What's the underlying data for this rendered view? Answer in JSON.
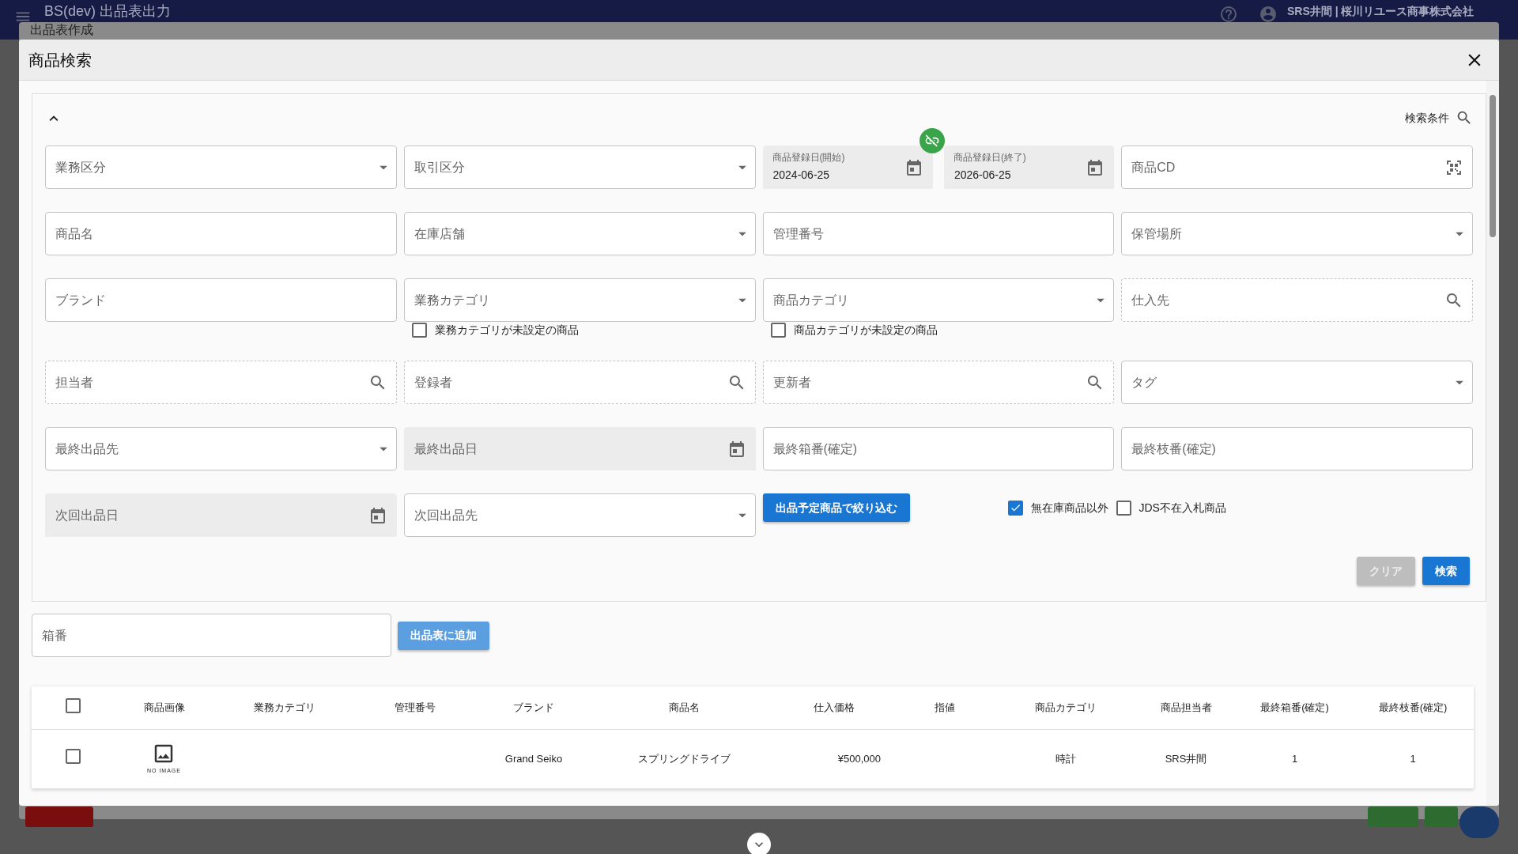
{
  "app_bar": {
    "title": "BS(dev) 出品表出力",
    "user": "SRS井間 | 桜川リユース商事株式会社"
  },
  "back_dialog": {
    "title": "出品表作成"
  },
  "dialog": {
    "title": "商品検索"
  },
  "search_panel": {
    "expanded": true,
    "title": "検索条件",
    "rows": [
      [
        {
          "kind": "select",
          "placeholder": "業務区分"
        },
        {
          "kind": "select",
          "placeholder": "取引区分"
        },
        {
          "kind": "date_range",
          "linked": false,
          "start": {
            "label": "商品登録日(開始)",
            "value": "2024-06-25"
          },
          "end": {
            "label": "商品登録日(終了)",
            "value": "2026-06-25"
          }
        },
        {
          "kind": "scan",
          "placeholder": "商品CD"
        }
      ],
      [
        {
          "kind": "text",
          "placeholder": "商品名"
        },
        {
          "kind": "select",
          "placeholder": "在庫店舗"
        },
        {
          "kind": "text",
          "placeholder": "管理番号"
        },
        {
          "kind": "select",
          "placeholder": "保管場所"
        }
      ],
      [
        {
          "kind": "text",
          "placeholder": "ブランド"
        },
        {
          "kind": "select",
          "placeholder": "業務カテゴリ",
          "checkbox": {
            "label": "業務カテゴリが未設定の商品",
            "checked": false
          }
        },
        {
          "kind": "select",
          "placeholder": "商品カテゴリ",
          "checkbox": {
            "label": "商品カテゴリが未設定の商品",
            "checked": false
          }
        },
        {
          "kind": "lookup",
          "placeholder": "仕入先"
        }
      ],
      [
        {
          "kind": "lookup",
          "placeholder": "担当者"
        },
        {
          "kind": "lookup",
          "placeholder": "登録者"
        },
        {
          "kind": "lookup",
          "placeholder": "更新者"
        },
        {
          "kind": "select",
          "placeholder": "タグ"
        }
      ],
      [
        {
          "kind": "select",
          "placeholder": "最終出品先"
        },
        {
          "kind": "date",
          "placeholder": "最終出品日"
        },
        {
          "kind": "text",
          "placeholder": "最終箱番(確定)"
        },
        {
          "kind": "text",
          "placeholder": "最終枝番(確定)"
        }
      ],
      [
        {
          "kind": "date",
          "placeholder": "次回出品日"
        },
        {
          "kind": "select",
          "placeholder": "次回出品先"
        },
        {
          "kind": "filter",
          "label": "出品予定商品で絞り込む",
          "checks": [
            {
              "label": "無在庫商品以外",
              "checked": true
            },
            {
              "label": "JDS不在入札商品",
              "checked": false
            }
          ]
        }
      ]
    ],
    "buttons": [
      {
        "label": "クリア",
        "disabled": true
      },
      {
        "label": "検索",
        "disabled": false
      }
    ]
  },
  "box_field": {
    "placeholder": "箱番",
    "button": "出品表に追加"
  },
  "table": {
    "all_checked": false,
    "columns": [
      "商品画像",
      "業務カテゴリ",
      "管理番号",
      "ブランド",
      "商品名",
      "仕入価格",
      "指値",
      "商品カテゴリ",
      "商品担当者",
      "最終箱番(確定)",
      "最終枝番(確定)"
    ],
    "rows": [
      {
        "checked": false,
        "cells": [
          "NO IMAGE",
          "",
          "",
          "Grand Seiko",
          "スプリングドライブ",
          "¥500,000",
          "",
          "時計",
          "SRS井間",
          "1",
          "1"
        ]
      }
    ]
  }
}
